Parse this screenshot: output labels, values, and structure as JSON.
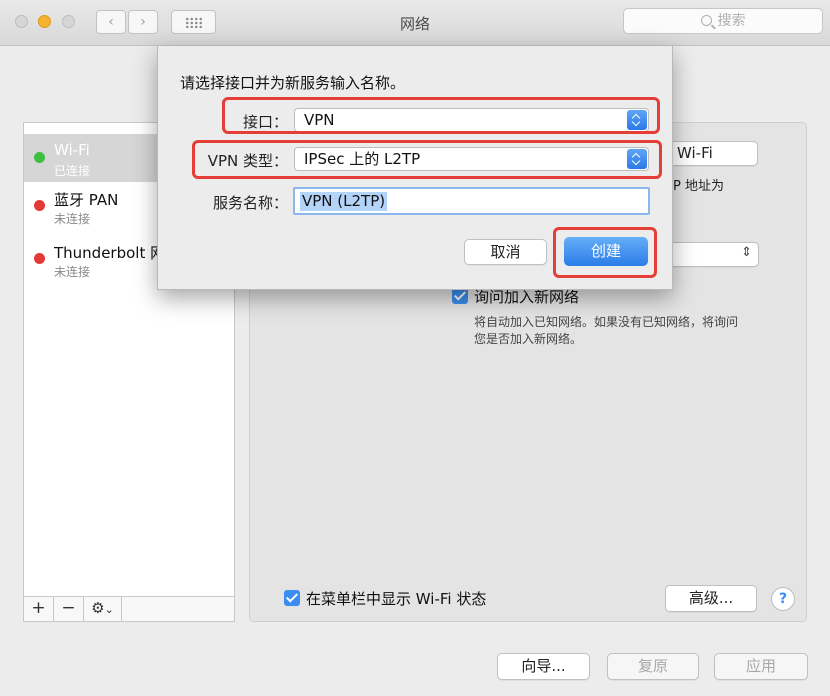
{
  "window": {
    "title": "网络",
    "search_placeholder": "搜索"
  },
  "sidebar": {
    "services": [
      {
        "name": "Wi-Fi",
        "status": "已连接",
        "dot_color": "#3fbe3f",
        "selected": true
      },
      {
        "name": "蓝牙 PAN",
        "status": "未连接",
        "dot_color": "#e23b35",
        "selected": false
      },
      {
        "name": "Thunderbolt 网桥",
        "status": "未连接",
        "dot_color": "#e23b35",
        "selected": false
      }
    ],
    "tools": {
      "add": "+",
      "remove": "−",
      "gear": "⚙",
      "gear_chevron": "⌄"
    }
  },
  "panel": {
    "wifi_button": "Wi-Fi",
    "ip_text_fragment": "P 地址为",
    "ask_to_join_label": "询问加入新网络",
    "ask_to_join_desc_line1": "将自动加入已知网络。如果没有已知网络，将询问",
    "ask_to_join_desc_line2": "您是否加入新网络。",
    "show_wifi_status_label": "在菜单栏中显示 Wi-Fi 状态",
    "advanced_button": "高级...",
    "help_label": "?"
  },
  "footer": {
    "assist_button": "向导...",
    "revert_button": "复原",
    "apply_button": "应用"
  },
  "dialog": {
    "prompt": "请选择接口并为新服务输入名称。",
    "interface_label": "接口：",
    "interface_value": "VPN",
    "vpn_type_label": "VPN 类型：",
    "vpn_type_value": "IPSec 上的 L2TP",
    "service_name_label": "服务名称：",
    "service_name_value": "VPN (L2TP)",
    "cancel_button": "取消",
    "create_button": "创建"
  },
  "colors": {
    "accent": "#3b8ef0",
    "annotation_red": "#e43e36",
    "connected_green": "#3fbe3f",
    "disconnected_red": "#e23b35"
  }
}
